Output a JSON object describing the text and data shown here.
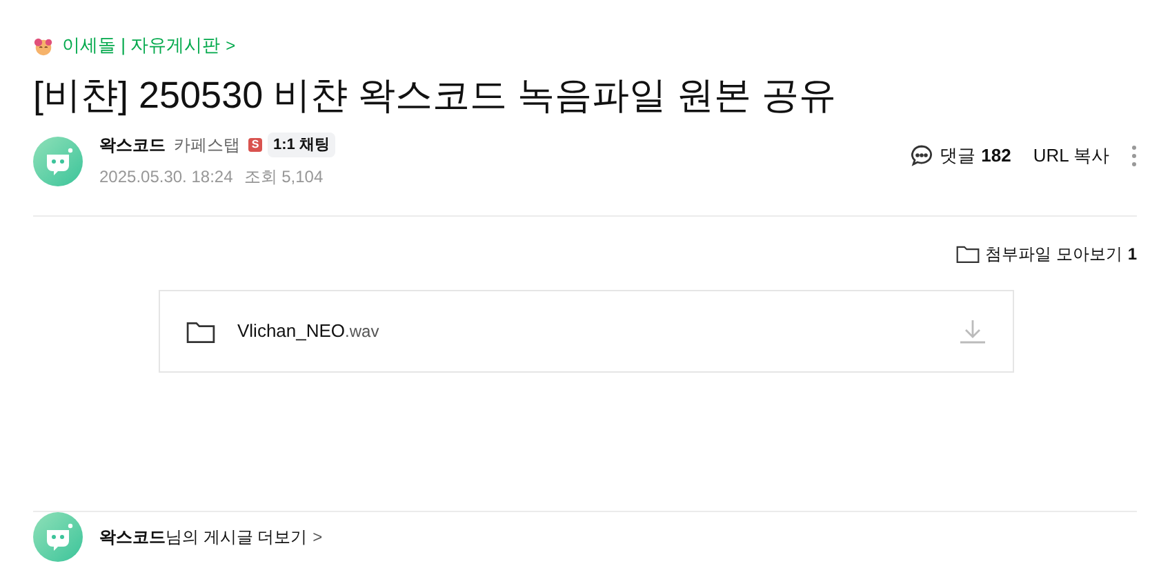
{
  "breadcrumb": {
    "text": "이세돌 | 자유게시판",
    "chevron": ">"
  },
  "title": "[비챤] 250530 비챤 왁스코드 녹음파일 원본 공유",
  "author": {
    "name": "왁스코드",
    "rank": "카페스탭",
    "rank_badge": "S",
    "chat": "1:1 채팅",
    "date": "2025.05.30. 18:24",
    "views_label": "조회",
    "views": "5,104"
  },
  "actions": {
    "comments_label": "댓글",
    "comments": "182",
    "copy_url": "URL 복사"
  },
  "attachments": {
    "label": "첨부파일 모아보기",
    "count": "1",
    "files": [
      {
        "name": "Vlichan_NEO",
        "ext": ".wav"
      }
    ]
  },
  "more_posts": {
    "text": "**왁스코드**님의 게시글 더보기",
    "chevron": ">"
  }
}
